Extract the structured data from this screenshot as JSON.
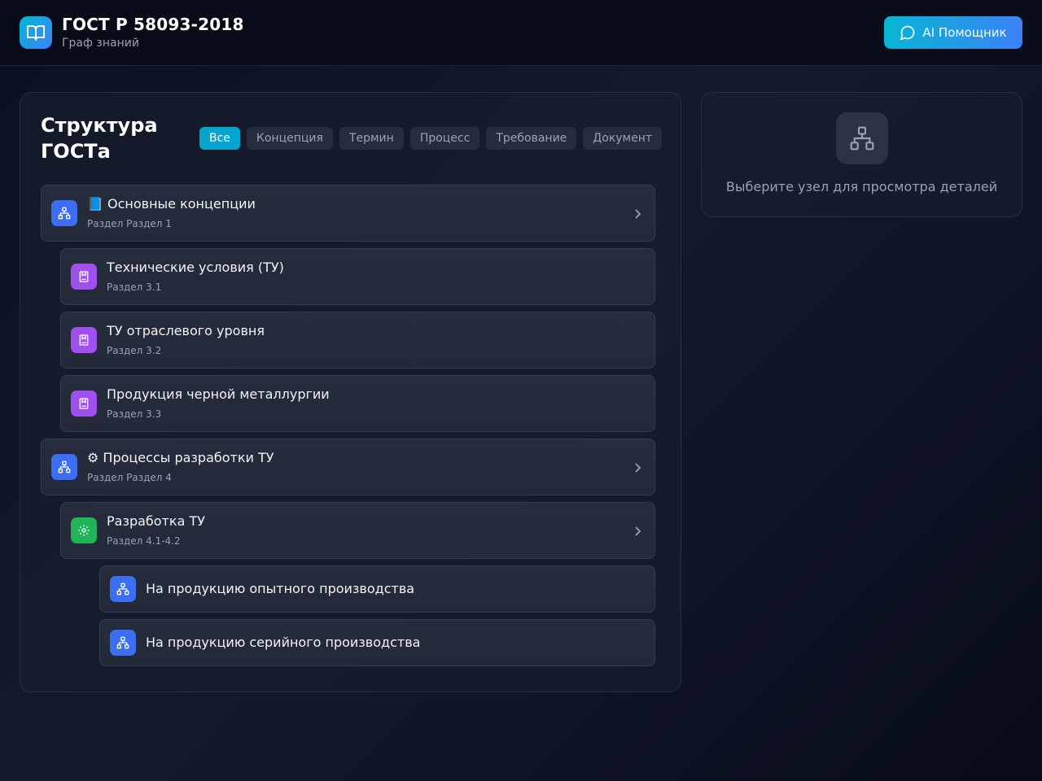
{
  "header": {
    "title": "ГОСТ Р 58093-2018",
    "subtitle": "Граф знаний",
    "ai_button_label": "AI Помощник"
  },
  "structure": {
    "title": "Структура ГОСТа",
    "filters": [
      "Все",
      "Концепция",
      "Термин",
      "Процесс",
      "Требование",
      "Документ"
    ],
    "active_filter": "Все",
    "nodes": [
      {
        "title": "📘 Основные концепции",
        "subtitle": "Раздел Раздел 1",
        "icon": "hierarchy-icon",
        "icon_color": "#3b6ef0",
        "level": 0,
        "expandable": true
      },
      {
        "title": "Технические условия (ТУ)",
        "subtitle": "Раздел 3.1",
        "icon": "book-icon",
        "icon_color": "#a150f0",
        "level": 1,
        "expandable": false
      },
      {
        "title": "ТУ отраслевого уровня",
        "subtitle": "Раздел 3.2",
        "icon": "book-icon",
        "icon_color": "#a150f0",
        "level": 1,
        "expandable": false
      },
      {
        "title": "Продукция черной металлургии",
        "subtitle": "Раздел 3.3",
        "icon": "book-icon",
        "icon_color": "#a150f0",
        "level": 1,
        "expandable": false
      },
      {
        "title": "⚙ Процессы разработки ТУ",
        "subtitle": "Раздел Раздел 4",
        "icon": "hierarchy-icon",
        "icon_color": "#3b6ef0",
        "level": 0,
        "expandable": true
      },
      {
        "title": "Разработка ТУ",
        "subtitle": "Раздел 4.1-4.2",
        "icon": "gear-icon",
        "icon_color": "#21b357",
        "level": 1,
        "expandable": true
      },
      {
        "title": "На продукцию опытного производства",
        "subtitle": "",
        "icon": "hierarchy-icon",
        "icon_color": "#3b6ef0",
        "level": 2,
        "expandable": false
      },
      {
        "title": "На продукцию серийного производства",
        "subtitle": "",
        "icon": "hierarchy-icon",
        "icon_color": "#3b6ef0",
        "level": 2,
        "expandable": false
      }
    ]
  },
  "details": {
    "placeholder": "Выберите узел для просмотра деталей",
    "icon": "hierarchy-icon"
  },
  "colors": {
    "accent": "#06b6d4",
    "accent_2": "#3b82f6",
    "background": "#0b1020"
  }
}
